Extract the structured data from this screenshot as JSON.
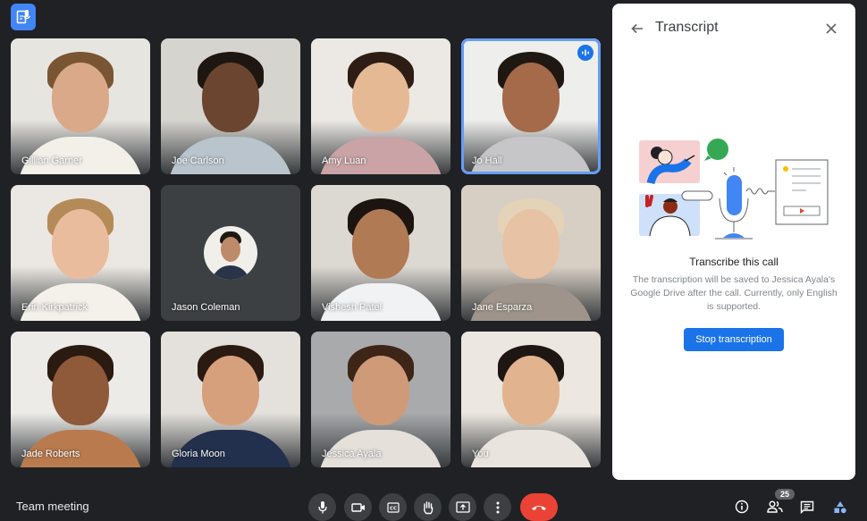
{
  "top_button": {
    "icon": "transcript-icon"
  },
  "participants": [
    {
      "name": "Gillian Garner",
      "bg": "#e7e5e0",
      "skin": "#d9a98a",
      "hair": "#7a5534",
      "shirt": "#f3f0ea"
    },
    {
      "name": "Joe Carlson",
      "bg": "#d6d4cf",
      "skin": "#6b4530",
      "hair": "#1e1610",
      "shirt": "#b9c4cc"
    },
    {
      "name": "Amy Luan",
      "bg": "#ece9e5",
      "skin": "#e6b995",
      "hair": "#2d1d15",
      "shirt": "#caa3a6"
    },
    {
      "name": "Jo Hall",
      "bg": "#eeeeec",
      "skin": "#a46a4a",
      "hair": "#1f1712",
      "shirt": "#c6c6c8",
      "speaking": true
    },
    {
      "name": "Erin Kirkpatrick",
      "bg": "#ebe7e2",
      "skin": "#e9bc9d",
      "hair": "#b48a58",
      "shirt": "#f4f0ea"
    },
    {
      "name": "Jason Coleman",
      "avatar": true,
      "skin": "#bd8b6a",
      "hair": "#1e1712",
      "shirt": "#2a3448"
    },
    {
      "name": "Vishesh Patel",
      "bg": "#dcd8d2",
      "skin": "#b07a55",
      "hair": "#1c1410",
      "shirt": "#f1f2f4"
    },
    {
      "name": "Jane Esparza",
      "bg": "#d8cfc4",
      "skin": "#e8c2a5",
      "hair": "#e5d3b7",
      "shirt": "#9e948b"
    },
    {
      "name": "Jade Roberts",
      "bg": "#ecebe7",
      "skin": "#8e5a3a",
      "hair": "#2b1a10",
      "shirt": "#b97a4e"
    },
    {
      "name": "Gloria Moon",
      "bg": "#e4e1dc",
      "skin": "#d7a07c",
      "hair": "#2a1a12",
      "shirt": "#23304d"
    },
    {
      "name": "Jessica Ayala",
      "bg": "#a9aaac",
      "skin": "#cf9a78",
      "hair": "#3d2518",
      "shirt": "#e5e0da"
    },
    {
      "name": "You",
      "bg": "#ece7e0",
      "skin": "#e2b38f",
      "hair": "#1e1612",
      "shirt": "#e9e4dd"
    }
  ],
  "panel": {
    "title": "Transcript",
    "back_icon": "arrow-back-icon",
    "close_icon": "close-icon",
    "heading": "Transcribe this call",
    "description": "The transcription will be saved to Jessica Ayala's Google Drive after the call. Currently, only English is supported.",
    "stop_button": "Stop transcription"
  },
  "bottom_bar": {
    "meeting_name": "Team meeting",
    "controls": [
      {
        "name": "microphone",
        "icon": "microphone-icon"
      },
      {
        "name": "camera",
        "icon": "camera-icon"
      },
      {
        "name": "captions",
        "icon": "captions-icon"
      },
      {
        "name": "raise-hand",
        "icon": "hand-icon"
      },
      {
        "name": "present",
        "icon": "present-icon"
      },
      {
        "name": "more-options",
        "icon": "more-vert-icon"
      },
      {
        "name": "end-call",
        "icon": "phone-hangup-icon"
      }
    ],
    "participants_count": "25",
    "right_controls": [
      {
        "name": "meeting-details",
        "icon": "info-icon"
      },
      {
        "name": "people",
        "icon": "people-icon"
      },
      {
        "name": "chat",
        "icon": "chat-icon"
      },
      {
        "name": "activities",
        "icon": "activities-icon"
      }
    ]
  },
  "colors": {
    "background": "#202124",
    "accent": "#1a73e8",
    "end_call": "#ea4335",
    "active_border": "#669df6"
  }
}
